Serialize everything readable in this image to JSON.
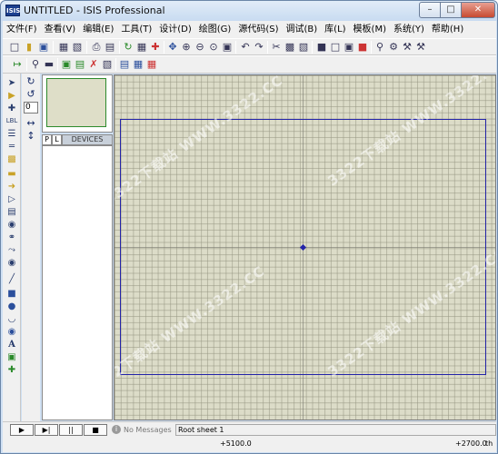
{
  "window": {
    "title": "UNTITLED - ISIS Professional",
    "app_icon_text": "ISIS",
    "min_glyph": "–",
    "max_glyph": "□",
    "close_glyph": "✕"
  },
  "menu": [
    "文件(F)",
    "查看(V)",
    "编辑(E)",
    "工具(T)",
    "设计(D)",
    "绘图(G)",
    "源代码(S)",
    "调试(B)",
    "库(L)",
    "模板(M)",
    "系统(Y)",
    "帮助(H)"
  ],
  "rotate": {
    "angle_value": "0",
    "rotate_cw_glyph": "↻",
    "rotate_ccw_glyph": "↺",
    "mirror_h_glyph": "↔",
    "mirror_v_glyph": "↕"
  },
  "device_panel": {
    "tab_p": "P",
    "tab_l": "L",
    "title": "DEVICES"
  },
  "watermark_text": "3322下载站 WWW.3322.CC",
  "status": {
    "play": "▶",
    "step": "▶|",
    "pause": "||",
    "stop": "■",
    "message_icon": "i",
    "messages": "No Messages",
    "sheet": "Root sheet 1"
  },
  "coords": {
    "x": "+5100.0",
    "y": "+2700.0",
    "unit": "th"
  },
  "colors": {
    "sheet_border": "#2323a8",
    "canvas_bg": "#dcdcc8",
    "overview_border": "#2c8a2c"
  }
}
